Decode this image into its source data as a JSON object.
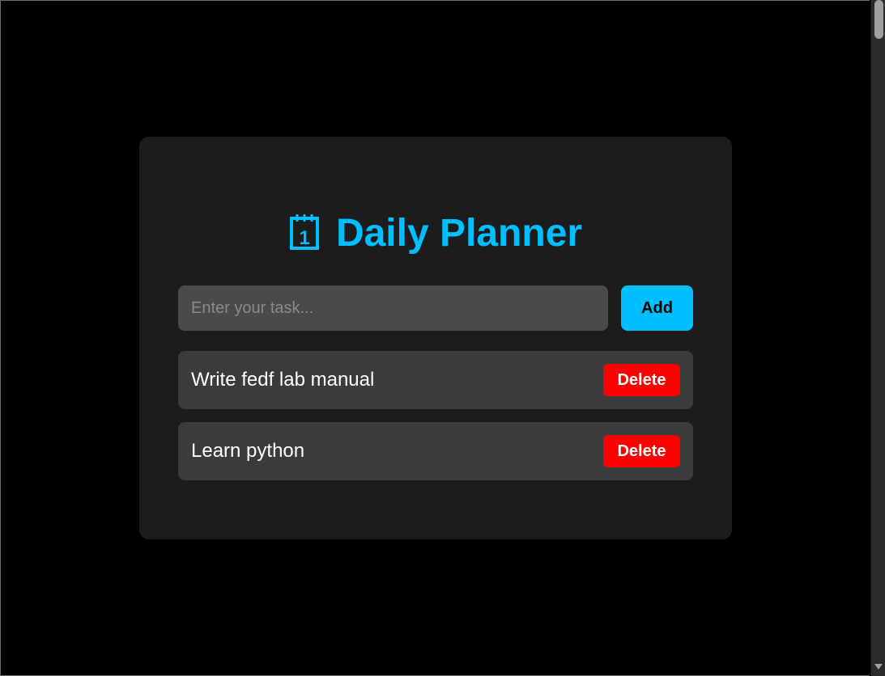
{
  "app": {
    "title": "Daily Planner",
    "title_icon": "calendar-icon",
    "title_icon_text": "1",
    "accent_color": "#00bfff"
  },
  "form": {
    "input_value": "",
    "input_placeholder": "Enter your task...",
    "add_label": "Add"
  },
  "tasks": [
    {
      "text": "Write fedf lab manual",
      "delete_label": "Delete"
    },
    {
      "text": "Learn python",
      "delete_label": "Delete"
    }
  ],
  "colors": {
    "page_background": "#000000",
    "card_background": "#1c1c1c",
    "input_background": "#4a4a4a",
    "task_background": "#3b3b3b",
    "delete_color": "#ff0000"
  }
}
